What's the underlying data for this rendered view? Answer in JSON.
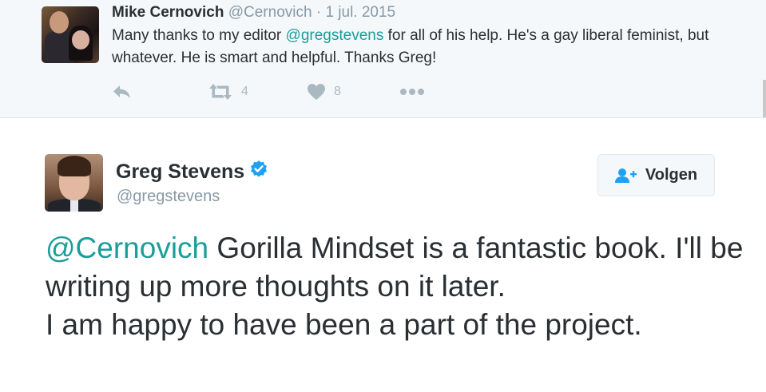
{
  "parent_tweet": {
    "display_name": "Mike Cernovich",
    "handle": "@Cernovich",
    "separator": "·",
    "date": "1 jul. 2015",
    "text_before": "Many thanks to my editor ",
    "mention": "@gregstevens",
    "text_after": " for all of his help. He's a gay liberal feminist, but whatever. He is smart and helpful. Thanks Greg!",
    "actions": {
      "reply_icon": "reply-icon",
      "retweet_icon": "retweet-icon",
      "retweet_count": "4",
      "like_icon": "heart-icon",
      "like_count": "8",
      "more_icon": "more-icon"
    }
  },
  "main_tweet": {
    "display_name": "Greg Stevens",
    "verified_icon": "verified-badge-icon",
    "handle": "@gregstevens",
    "follow_button": {
      "icon": "add-user-icon",
      "label": "Volgen"
    },
    "mention": "@Cernovich",
    "line1_rest": " Gorilla Mindset is a fantastic book. I'll be writing up more thoughts on it later.",
    "line2": "I am happy to have been a part of the project."
  },
  "colors": {
    "link": "#1a9e99",
    "text": "#292f33",
    "muted": "#8899a6",
    "icon": "#aab8c2",
    "verified": "#1da1f2",
    "follow_icon": "#1da1f2",
    "parent_background": "#f5f8fa"
  }
}
